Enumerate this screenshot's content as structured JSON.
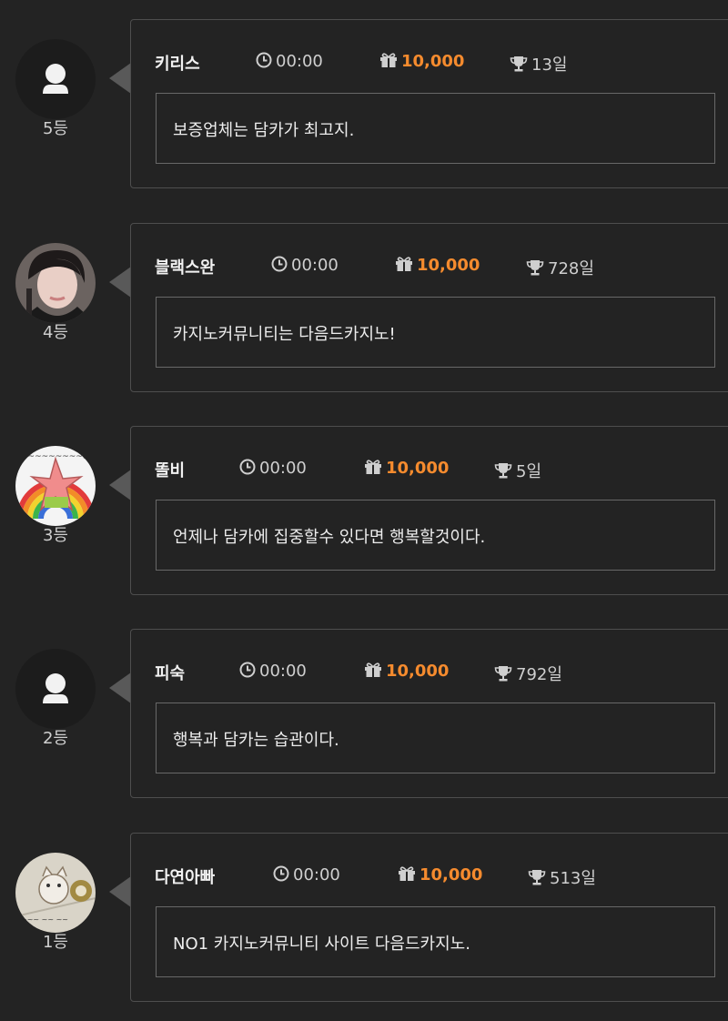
{
  "entries": [
    {
      "rank": "5등",
      "nickname": "키리스",
      "time": "00:00",
      "points": "10,000",
      "days": "13일",
      "message": "보증업체는 담카가 최고지.",
      "avatar": "default-user-icon"
    },
    {
      "rank": "4등",
      "nickname": "블랙스완",
      "time": "00:00",
      "points": "10,000",
      "days": "728일",
      "message": "카지노커뮤니티는 다음드카지노!",
      "avatar": "photo-woman"
    },
    {
      "rank": "3등",
      "nickname": "똘비",
      "time": "00:00",
      "points": "10,000",
      "days": "5일",
      "message": "언제나 담카에 집중할수 있다면 행복할것이다.",
      "avatar": "photo-starfish-rainbow"
    },
    {
      "rank": "2등",
      "nickname": "피숙",
      "time": "00:00",
      "points": "10,000",
      "days": "792일",
      "message": "행복과 담카는 습관이다.",
      "avatar": "default-user-icon"
    },
    {
      "rank": "1등",
      "nickname": "다연아빠",
      "time": "00:00",
      "points": "10,000",
      "days": "513일",
      "message": "NO1 카지노커뮤니티 사이트 다음드카지노.",
      "avatar": "photo-sketch"
    }
  ],
  "icons": {
    "time": "clock-icon",
    "points": "gift-icon",
    "days": "trophy-icon"
  },
  "colors": {
    "background": "#232323",
    "accent_points": "#f58b2e",
    "card_border": "#4e4e4e"
  }
}
